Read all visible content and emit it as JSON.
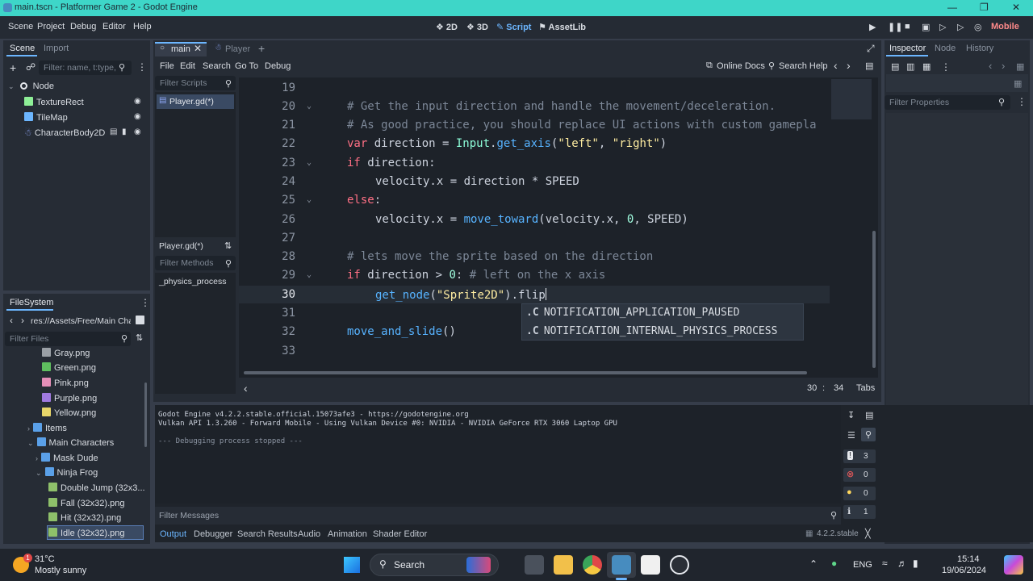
{
  "window": {
    "title": "main.tscn - Platformer Game 2 - Godot Engine"
  },
  "main_menu": [
    "Scene",
    "Project",
    "Debug",
    "Editor",
    "Help"
  ],
  "workspaces": [
    {
      "label": "2D",
      "active": false
    },
    {
      "label": "3D",
      "active": false
    },
    {
      "label": "Script",
      "active": true
    },
    {
      "label": "AssetLib",
      "active": false
    }
  ],
  "renderer": "Mobile",
  "scene_dock": {
    "tabs": [
      "Scene",
      "Import"
    ],
    "filter_placeholder": "Filter: name, t:type,",
    "nodes": [
      {
        "label": "Node",
        "icon": "node-icon"
      },
      {
        "label": "TextureRect",
        "icon": "texturerect-icon"
      },
      {
        "label": "TileMap",
        "icon": "tilemap-icon"
      },
      {
        "label": "CharacterBody2D",
        "icon": "characterbody2d-icon"
      }
    ]
  },
  "filesystem_dock": {
    "title": "FileSystem",
    "path": "res://Assets/Free/Main Cha",
    "filter_placeholder": "Filter Files",
    "items": [
      {
        "label": "Gray.png",
        "color": "#9aa0a6"
      },
      {
        "label": "Green.png",
        "color": "#5fbf5f"
      },
      {
        "label": "Pink.png",
        "color": "#e58fb8"
      },
      {
        "label": "Purple.png",
        "color": "#a07ae0"
      },
      {
        "label": "Yellow.png",
        "color": "#e8d66a"
      },
      {
        "label": "Items",
        "color": "#5aa0e8"
      },
      {
        "label": "Main Characters",
        "color": "#5aa0e8"
      },
      {
        "label": "Mask Dude",
        "color": "#5aa0e8"
      },
      {
        "label": "Ninja Frog",
        "color": "#5aa0e8"
      },
      {
        "label": "Double Jump (32x3...",
        "color": "#8ec06a"
      },
      {
        "label": "Fall (32x32).png",
        "color": "#8ec06a"
      },
      {
        "label": "Hit (32x32).png",
        "color": "#8ec06a"
      },
      {
        "label": "Idle (32x32).png",
        "color": "#8ec06a"
      }
    ]
  },
  "script_tabs": [
    {
      "label": "main",
      "active": true
    },
    {
      "label": "Player",
      "active": false
    }
  ],
  "script_menu": [
    "File",
    "Edit",
    "Search",
    "Go To",
    "Debug"
  ],
  "script_toolbar": {
    "online_docs": "Online Docs",
    "search_help": "Search Help"
  },
  "script_list": {
    "filter_placeholder": "Filter Scripts",
    "scripts": [
      "Player.gd(*)"
    ],
    "current": "Player.gd(*)",
    "methods_placeholder": "Filter Methods",
    "methods": [
      "_physics_process"
    ]
  },
  "code": {
    "line_numbers": [
      "19",
      "20",
      "21",
      "22",
      "23",
      "24",
      "25",
      "26",
      "27",
      "28",
      "29",
      "30",
      "31",
      "32",
      "33"
    ],
    "line20": "# Get the input direction and handle the movement/deceleration.",
    "line21": "# As good practice, you should replace UI actions with custom gamepla",
    "line22": {
      "kw": "var",
      "a": " direction = ",
      "cls": "Input",
      "b": ".",
      "fn": "get_axis",
      "c": "(",
      "s1": "\"left\"",
      "d": ", ",
      "s2": "\"right\"",
      "e": ")"
    },
    "line23": {
      "kw": "if",
      "a": " direction:"
    },
    "line24": "velocity.x = direction * SPEED",
    "line25": {
      "kw": "else",
      "a": ":"
    },
    "line26": {
      "a": "velocity.x = ",
      "fn": "move_toward",
      "b": "(velocity.x, ",
      "num": "0",
      "c": ", SPEED)"
    },
    "line28": "# lets move the sprite based on the direction",
    "line29": {
      "kw": "if",
      "a": " direction > ",
      "num": "0",
      "b": ": ",
      "cm": "# left on the x axis"
    },
    "line30": {
      "fn": "get_node",
      "a": "(",
      "s": "\"Sprite2D\"",
      "b": ").flip"
    },
    "line32": {
      "fn": "move_and_slide",
      "a": "()"
    }
  },
  "autocomplete": [
    "NOTIFICATION_APPLICATION_PAUSED",
    "NOTIFICATION_INTERNAL_PHYSICS_PROCESS"
  ],
  "status": {
    "line": "30",
    "sep": ":",
    "col": "34",
    "indent": "Tabs"
  },
  "inspector": {
    "tabs": [
      "Inspector",
      "Node",
      "History"
    ],
    "filter_placeholder": "Filter Properties"
  },
  "output": {
    "lines": [
      "Godot Engine v4.2.2.stable.official.15073afe3 - https://godotengine.org",
      "Vulkan API 1.3.260 - Forward Mobile - Using Vulkan Device #0: NVIDIA - NVIDIA GeForce RTX 3060 Laptop GPU",
      "",
      "--- Debugging process stopped ---"
    ],
    "filter_placeholder": "Filter Messages",
    "counts": {
      "log": "3",
      "errors": "0",
      "warnings": "0",
      "info": "1"
    }
  },
  "bottom_tabs": [
    "Output",
    "Debugger",
    "Search Results",
    "Audio",
    "Animation",
    "Shader Editor"
  ],
  "version": "4.2.2.stable",
  "taskbar": {
    "weather_temp": "31°C",
    "weather_desc": "Mostly sunny",
    "weather_badge": "1",
    "search_label": "Search",
    "language": "ENG",
    "time": "15:14",
    "date": "19/06/2024"
  }
}
